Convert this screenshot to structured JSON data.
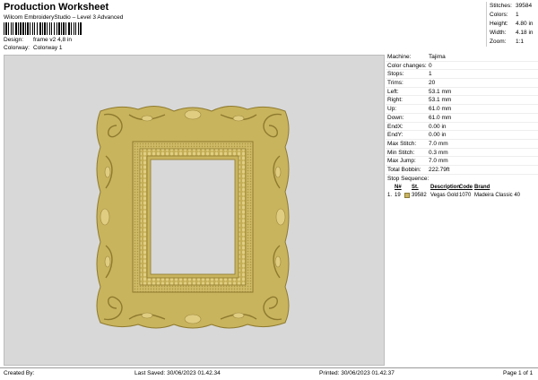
{
  "header": {
    "title": "Production Worksheet",
    "subtitle": "Wilcom EmbroideryStudio – Level 3 Advanced",
    "design_label": "Design:",
    "design_value": "frame v2 4,8 in",
    "colorway_label": "Colorway:",
    "colorway_value": "Colorway 1"
  },
  "summary": {
    "stitches_label": "Stitches:",
    "stitches": "39584",
    "colors_label": "Colors:",
    "colors": "1",
    "height_label": "Height:",
    "height": "4.80 in",
    "width_label": "Width:",
    "width": "4.18 in",
    "zoom_label": "Zoom:",
    "zoom": "1:1"
  },
  "details": [
    {
      "label": "Machine:",
      "value": "Tajima"
    },
    {
      "label": "Color changes:",
      "value": "0"
    },
    {
      "label": "Stops:",
      "value": "1"
    },
    {
      "label": "Trims:",
      "value": "20"
    },
    {
      "label": "Left:",
      "value": "53.1 mm"
    },
    {
      "label": "Right:",
      "value": "53.1 mm"
    },
    {
      "label": "Up:",
      "value": "61.0 mm"
    },
    {
      "label": "Down:",
      "value": "61.0 mm"
    },
    {
      "label": "EndX:",
      "value": "0.00 in"
    },
    {
      "label": "EndY:",
      "value": "0.00 in"
    },
    {
      "label": "Max Stitch:",
      "value": "7.0 mm"
    },
    {
      "label": "Min Stitch:",
      "value": "0.3 mm"
    },
    {
      "label": "Max Jump:",
      "value": "7.0 mm"
    },
    {
      "label": "Total Bobbin:",
      "value": "222.79ft"
    }
  ],
  "stop_sequence": {
    "title": "Stop Sequence:",
    "headers": {
      "n": "N#",
      "st": "St.",
      "description": "Description",
      "code": "Code",
      "brand": "Brand"
    },
    "rows": [
      {
        "index": "1.",
        "n": "19",
        "color": "#c9b45e",
        "st": "39582",
        "description": "Vegas Gold",
        "code": "1070",
        "brand": "Madeira Classic 40"
      }
    ]
  },
  "footer": {
    "created_by": "Created By:",
    "last_saved": "Last Saved: 30/06/2023 01.42.34",
    "printed": "Printed: 30/06/2023 01.42.37",
    "page": "Page 1 of 1"
  },
  "colors": {
    "thread": "#c9b45e",
    "thread_dark": "#8e7a2e",
    "canvas": "#d8d8d8"
  }
}
